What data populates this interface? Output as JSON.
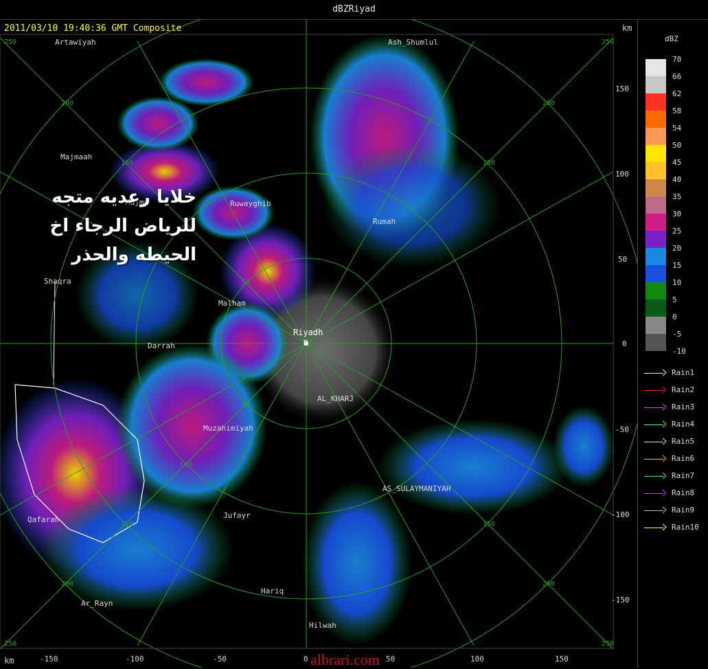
{
  "window": {
    "title": "dBZRiyad"
  },
  "header": {
    "timestamp": "2011/03/10 19:40:36 GMT Composite",
    "km_label": "km"
  },
  "legend": {
    "unit": "dBZ",
    "levels": [
      {
        "label": "70",
        "color": "#e6e6e6"
      },
      {
        "label": "66",
        "color": "#c8c8c8"
      },
      {
        "label": "62",
        "color": "#ff3322"
      },
      {
        "label": "58",
        "color": "#ff6a00"
      },
      {
        "label": "54",
        "color": "#ff9955"
      },
      {
        "label": "50",
        "color": "#ffe600"
      },
      {
        "label": "45",
        "color": "#ffc02a"
      },
      {
        "label": "40",
        "color": "#cc8844"
      },
      {
        "label": "35",
        "color": "#c06a8a"
      },
      {
        "label": "30",
        "color": "#cc1e86"
      },
      {
        "label": "25",
        "color": "#7a22c8"
      },
      {
        "label": "20",
        "color": "#1a8ae0"
      },
      {
        "label": "15",
        "color": "#1850e0"
      },
      {
        "label": "10",
        "color": "#118811"
      },
      {
        "label": "5",
        "color": "#0a5a1a"
      },
      {
        "label": "0",
        "color": "#888888"
      },
      {
        "label": "-5",
        "color": "#555555"
      },
      {
        "label": "-10",
        "color": "#000000"
      }
    ],
    "rain": [
      {
        "label": "Rain1",
        "color": "#ffff66"
      },
      {
        "label": "Rain2",
        "color": "#ee2222"
      },
      {
        "label": "Rain3",
        "color": "#ee44ee"
      },
      {
        "label": "Rain4",
        "color": "#66ee66"
      },
      {
        "label": "Rain5",
        "color": "#ffcccc"
      },
      {
        "label": "Rain6",
        "color": "#ffaa55"
      },
      {
        "label": "Rain7",
        "color": "#44dddd"
      },
      {
        "label": "Rain8",
        "color": "#aa44ff"
      },
      {
        "label": "Rain9",
        "color": "#ddbb88"
      },
      {
        "label": "Rain10",
        "color": "#ffff66"
      }
    ]
  },
  "annotation": {
    "lines": [
      "خلايا رعديه متجه",
      "للرياض الرجاء اخ",
      "الحيطه والحذر"
    ]
  },
  "places": {
    "artawiyah": "Artawiyah",
    "ash_shumlul": "Ash_Shumlul",
    "majmaah": "Majmaah",
    "zulfi": "Majma",
    "ruwayghib": "Ruwayghib",
    "rumah": "Rumah",
    "shaqra": "Shaqra",
    "malham": "Malham",
    "riyadh": "Riyadh",
    "riyadh_marker": "R",
    "durma": "Darrah",
    "al_kharj": "AL_KHARJ",
    "muzahimiyah": "Muzahimiyah",
    "as_sulaymaniyah": "AS_SULAYMANIYAH",
    "jufayr": "Jufayr",
    "qafarah": "Qafarah",
    "hariq": "Hariq",
    "ar_rayn": "Ar_Rayn",
    "hilwah": "Hilwah"
  },
  "axis": {
    "x_ticks": [
      "-150",
      "-100",
      "-50",
      "0",
      "50",
      "100",
      "150"
    ],
    "y_ticks": [
      "150",
      "100",
      "50",
      "0",
      "-50",
      "-100",
      "-150"
    ],
    "ring_labels": [
      "50",
      "100",
      "150",
      "200",
      "250"
    ],
    "corner_labels": [
      "250",
      "250",
      "250",
      "250"
    ]
  },
  "watermark": "albrari.com"
}
